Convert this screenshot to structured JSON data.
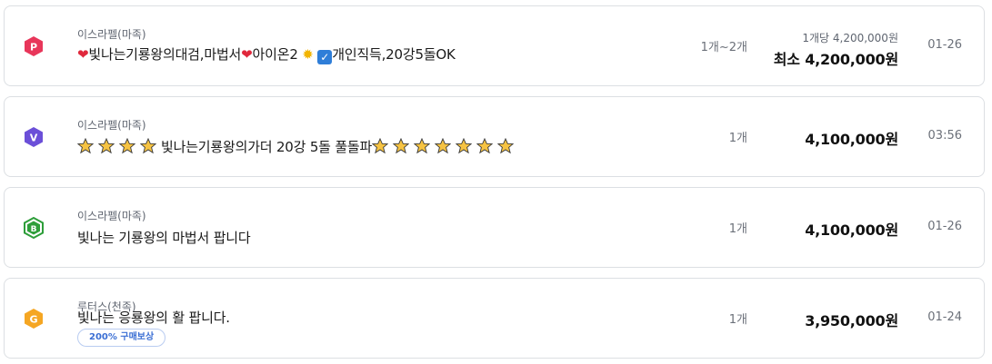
{
  "listings": [
    {
      "badge": {
        "letter": "P",
        "color": "#e8365a",
        "icon": "server-badge-p-icon"
      },
      "server": "이스라펠(마족)",
      "title_parts": [
        "빛나는기룡왕의대검,마법서",
        "아이온2",
        "개인직득,20강5돌OK"
      ],
      "quantity": "1개~2개",
      "unit_price": "1개당 4,200,000원",
      "price": "최소 4,200,000원",
      "date": "01-26"
    },
    {
      "badge": {
        "letter": "V",
        "color": "#6b4fd8",
        "icon": "server-badge-v-icon"
      },
      "server": "이스라펠(마족)",
      "title_middle": "빛나는기룡왕의가더 20강 5돌 풀돌파",
      "quantity": "1개",
      "price": "4,100,000원",
      "date": "03:56"
    },
    {
      "badge": {
        "letter": "B",
        "color": "#2e9e3a",
        "icon": "server-badge-b-icon"
      },
      "server": "이스라펠(마족)",
      "title": "빛나는 기룡왕의 마법서 팝니다",
      "quantity": "1개",
      "price": "4,100,000원",
      "date": "01-26"
    },
    {
      "badge": {
        "letter": "G",
        "color": "#f5a623",
        "icon": "server-badge-g-icon"
      },
      "server": "루터스(천족)",
      "title": "빛나는 응룡왕의 활 팝니다.",
      "tag": "200% 구매보상",
      "quantity": "1개",
      "price": "3,950,000원",
      "date": "01-24"
    }
  ],
  "colors": {
    "border": "#dcdfe3",
    "tag_text": "#3b6fd4",
    "tag_border": "#b9ccf1",
    "heart": "#e0283c",
    "check_box": "#2f7ed8"
  }
}
